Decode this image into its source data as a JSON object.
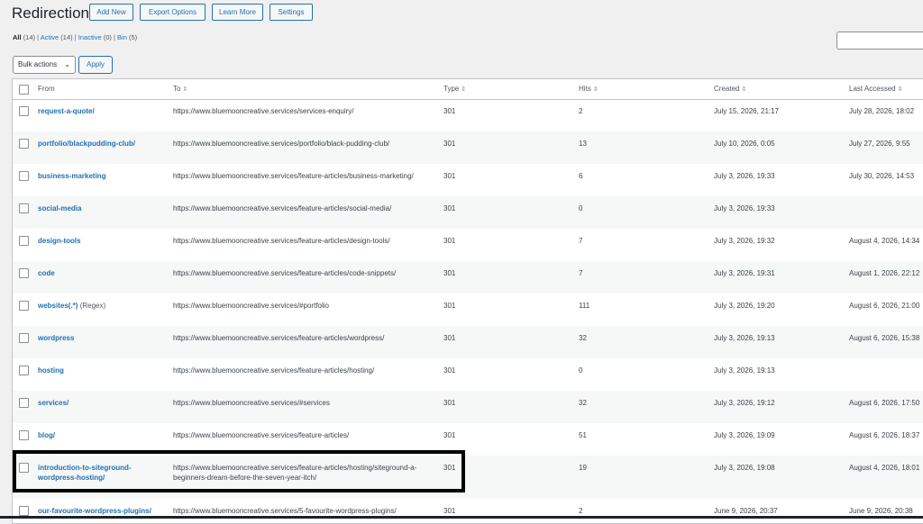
{
  "header": {
    "title": "Redirections",
    "buttons": [
      "Add New",
      "Export Options",
      "Learn More",
      "Settings"
    ]
  },
  "filters": [
    {
      "label": "All",
      "count": "(14)",
      "current": true
    },
    {
      "label": "Active",
      "count": "(14)"
    },
    {
      "label": "Inactive",
      "count": "(0)"
    },
    {
      "label": "Bin",
      "count": "(5)"
    }
  ],
  "search": {
    "value": ""
  },
  "bulk_actions": {
    "label": "Bulk actions",
    "apply": "Apply"
  },
  "columns": {
    "from": "From",
    "to": "To",
    "type": "Type",
    "hits": "Hits",
    "created": "Created",
    "last_accessed": "Last Accessed"
  },
  "rows": [
    {
      "from": "request-a-quote/",
      "regex": "",
      "to": "https://www.bluemooncreative.services/services-enquiry/",
      "type": "301",
      "hits": "2",
      "created": "July 15, 2026, 21:17",
      "last_accessed": "July 28, 2026, 18:02"
    },
    {
      "from": "portfolio/blackpudding-club/",
      "regex": "",
      "to": "https://www.bluemooncreative.services/portfolio/black-pudding-club/",
      "type": "301",
      "hits": "13",
      "created": "July 10, 2026, 0:05",
      "last_accessed": "July 27, 2026, 9:55"
    },
    {
      "from": "business-marketing",
      "regex": "",
      "to": "https://www.bluemooncreative.services/feature-articles/business-marketing/",
      "type": "301",
      "hits": "6",
      "created": "July 3, 2026, 19:33",
      "last_accessed": "July 30, 2026, 14:53"
    },
    {
      "from": "social-media",
      "regex": "",
      "to": "https://www.bluemooncreative.services/feature-articles/social-media/",
      "type": "301",
      "hits": "0",
      "created": "July 3, 2026, 19:33",
      "last_accessed": ""
    },
    {
      "from": "design-tools",
      "regex": "",
      "to": "https://www.bluemooncreative.services/feature-articles/design-tools/",
      "type": "301",
      "hits": "7",
      "created": "July 3, 2026, 19:32",
      "last_accessed": "August 4, 2026, 14:34"
    },
    {
      "from": "code",
      "regex": "",
      "to": "https://www.bluemooncreative.services/feature-articles/code-snippets/",
      "type": "301",
      "hits": "7",
      "created": "July 3, 2026, 19:31",
      "last_accessed": "August 1, 2026, 22:12"
    },
    {
      "from": "websites(.*)",
      "regex": "(Regex)",
      "to": "https://www.bluemooncreative.services/#portfolio",
      "type": "301",
      "hits": "111",
      "created": "July 3, 2026, 19:20",
      "last_accessed": "August 6, 2026, 21:00"
    },
    {
      "from": "wordpress",
      "regex": "",
      "to": "https://www.bluemooncreative.services/feature-articles/wordpress/",
      "type": "301",
      "hits": "32",
      "created": "July 3, 2026, 19:13",
      "last_accessed": "August 6, 2026, 15:38"
    },
    {
      "from": "hosting",
      "regex": "",
      "to": "https://www.bluemooncreative.services/feature-articles/hosting/",
      "type": "301",
      "hits": "0",
      "created": "July 3, 2026, 19:13",
      "last_accessed": ""
    },
    {
      "from": "services/",
      "regex": "",
      "to": "https://www.bluemooncreative.services/#services",
      "type": "301",
      "hits": "32",
      "created": "July 3, 2026, 19:12",
      "last_accessed": "August 6, 2026, 17:50"
    },
    {
      "from": "blog/",
      "regex": "",
      "to": "https://www.bluemooncreative.services/feature-articles/",
      "type": "301",
      "hits": "51",
      "created": "July 3, 2026, 19:09",
      "last_accessed": "August 6, 2026, 18:37"
    },
    {
      "from": "introduction-to-siteground-wordpress-hosting/",
      "regex": "",
      "to": "https://www.bluemooncreative.services/feature-articles/hosting/siteground-a-beginners-dream-before-the-seven-year-itch/",
      "type": "301",
      "hits": "19",
      "created": "July 3, 2026, 19:08",
      "last_accessed": "August 4, 2026, 18:01"
    },
    {
      "from": "our-favourite-wordpress-plugins/",
      "regex": "",
      "to": "https://www.bluemooncreative.services/5-favourite-wordpress-plugins/",
      "type": "301",
      "hits": "2",
      "created": "June 9, 2026, 20:37",
      "last_accessed": "June 9, 2026, 20:38"
    }
  ]
}
